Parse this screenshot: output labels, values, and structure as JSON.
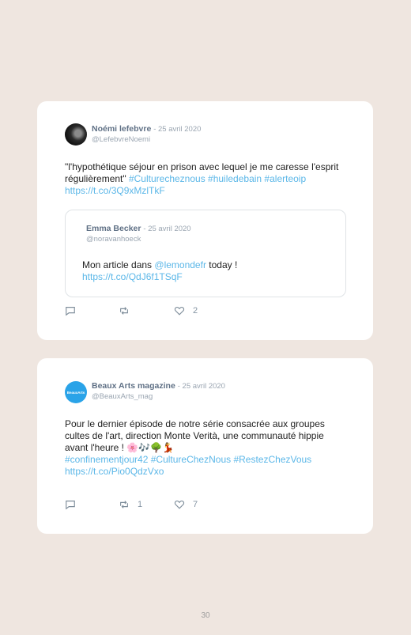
{
  "tweets": [
    {
      "author": "Noémi lefebvre",
      "date": "- 25 avril 2020",
      "handle": "@LefebvreNoemi",
      "text_plain": "\"l'hypothétique séjour en prison avec lequel je me caresse l'esprit régulièrement\" ",
      "text_links": "#Culturecheznous #huiledebain #alerteoip https://t.co/3Q9xMzlTkF",
      "quoted": {
        "author": "Emma Becker",
        "date": "- 25 avril 2020",
        "handle": "@noravanhoeck",
        "text_before": "Mon article dans ",
        "mention": "@lemondefr",
        "text_after": " today !",
        "link": "https://t.co/QdJ6f1TSqF"
      },
      "replies": "",
      "retweets": "",
      "likes": "2"
    },
    {
      "author": "Beaux Arts magazine",
      "date": "- 25 avril 2020",
      "handle": "@BeauxArts_mag",
      "avatar_text": "BeauxArts",
      "text_plain": "Pour le dernier épisode de notre série consacrée aux groupes cultes de l'art, direction Monte Verità, une communauté hippie avant l'heure ! 🌸🎶🌳💃",
      "text_links": "#confinementjour42 #CultureChezNous #RestezChezVous https://t.co/Pio0QdzVxo",
      "replies": "",
      "retweets": "1",
      "likes": "7"
    }
  ],
  "page_number": "30",
  "colors": {
    "background": "#efe6e0",
    "link": "#5bb7e8",
    "meta": "#9aa5b1"
  }
}
